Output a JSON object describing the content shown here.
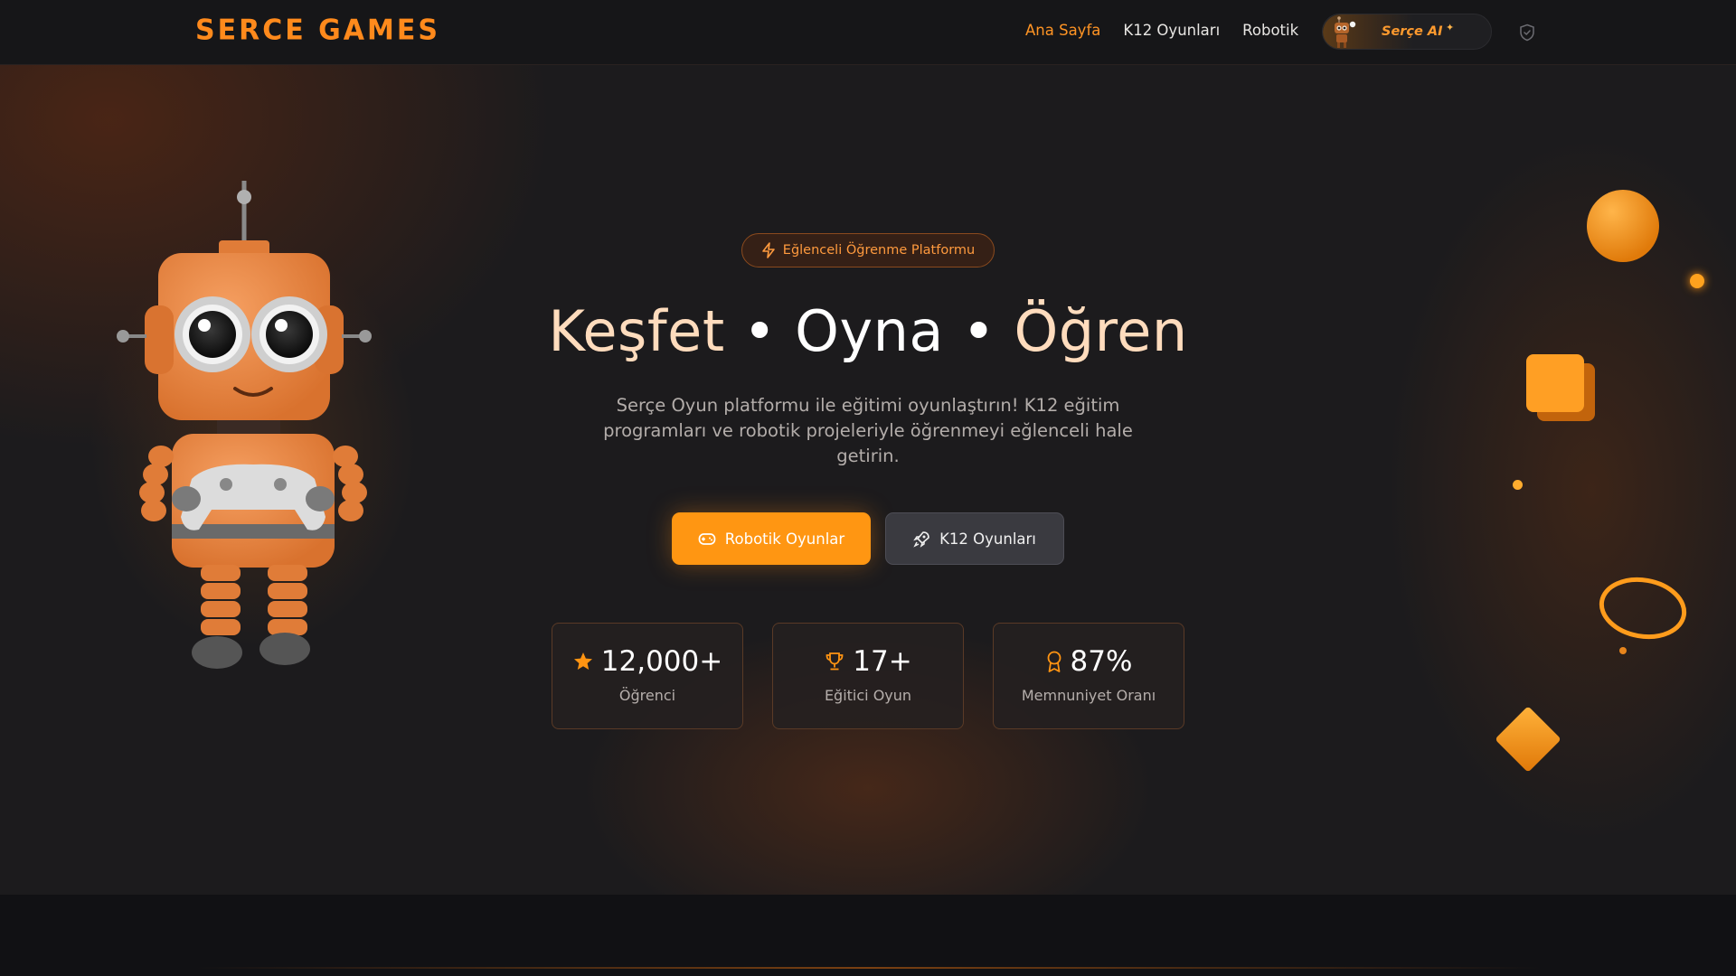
{
  "brand": {
    "logo": "SERCE GAMES",
    "accent": "#ff8a1c"
  },
  "nav": {
    "links": [
      {
        "label": "Ana Sayfa",
        "active": true
      },
      {
        "label": "K12 Oyunları",
        "active": false
      },
      {
        "label": "Robotik",
        "active": false
      }
    ],
    "ai_button": {
      "label": "Serçe AI",
      "icon": "robot-avatar-icon"
    },
    "shield_icon": "shield-icon"
  },
  "hero": {
    "badge": {
      "label": "Eğlenceli Öğrenme Platformu",
      "icon": "lightning-icon"
    },
    "headline": {
      "part1": "Keşfet",
      "sep1": "•",
      "part2": "Oyna",
      "sep2": "•",
      "part3": "Öğren"
    },
    "subtitle": "Serçe Oyun platformu ile eğitimi oyunlaştırın! K12 eğitim programları ve robotik projeleriyle öğrenmeyi eğlenceli hale getirin.",
    "buttons": {
      "primary": {
        "label": "Robotik Oyunlar",
        "icon": "gamepad-icon"
      },
      "secondary": {
        "label": "K12 Oyunları",
        "icon": "rocket-icon"
      }
    },
    "stats": [
      {
        "value": "12,000+",
        "label": "Öğrenci",
        "icon": "star-icon"
      },
      {
        "value": "17+",
        "label": "Eğitici Oyun",
        "icon": "trophy-icon"
      },
      {
        "value": "87%",
        "label": "Memnuniyet Oranı",
        "icon": "award-icon"
      }
    ]
  },
  "colors": {
    "primary_orange": "#ff9612",
    "background": "#1c1b1d",
    "navbar": "#161618",
    "secondary_button": "#3a3a40"
  }
}
